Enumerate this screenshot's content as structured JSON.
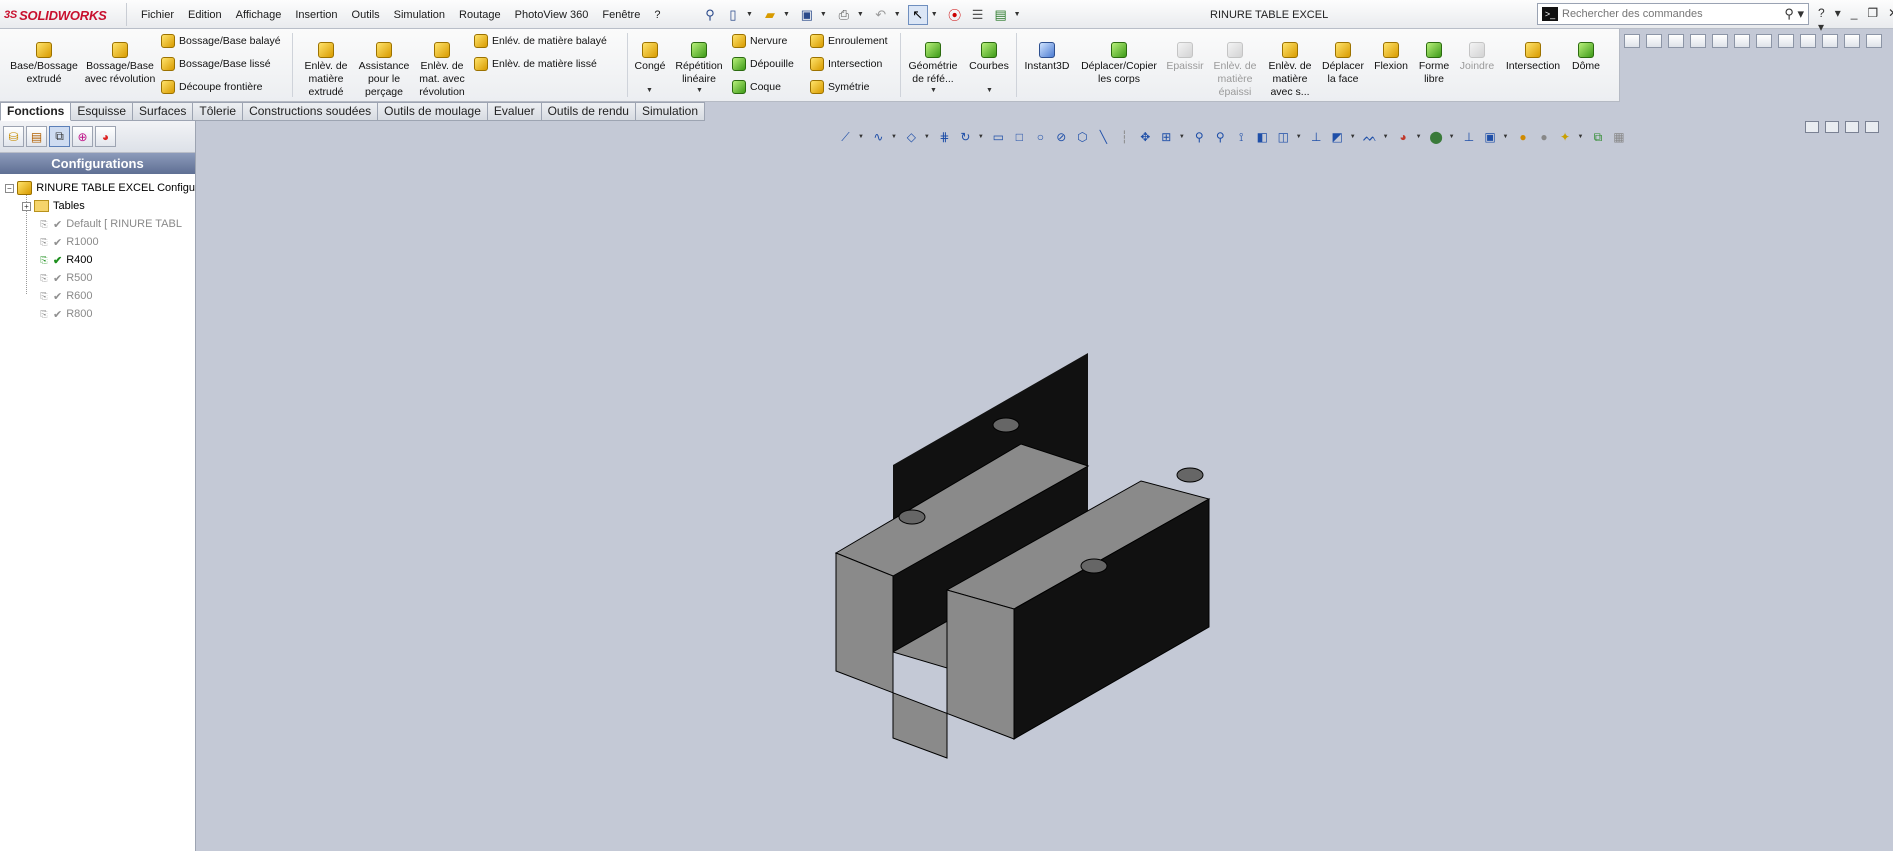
{
  "app": {
    "brand": "SOLIDWORKS",
    "brand_prefix": "3S",
    "document_title": "RINURE TABLE EXCEL",
    "brand_color": "#c8102e"
  },
  "menu": [
    "Fichier",
    "Edition",
    "Affichage",
    "Insertion",
    "Outils",
    "Simulation",
    "Routage",
    "PhotoView 360",
    "Fenêtre",
    "?"
  ],
  "search": {
    "placeholder": "Rechercher des commandes"
  },
  "quick_toolbar": {
    "icons": [
      "pin-icon",
      "new-document-icon",
      "open-icon",
      "save-icon",
      "print-icon",
      "undo-icon",
      "select-icon",
      "traffic-light-icon",
      "options-icon",
      "customize-icon"
    ]
  },
  "commands": {
    "large": [
      {
        "label": "Base/Bossage extrudé",
        "icon": "extruded-boss-icon",
        "enabled": true
      },
      {
        "label": "Bossage/Base avec révolution",
        "icon": "revolved-boss-icon",
        "enabled": true
      },
      {
        "label": "Enlèv. de matière extrudé",
        "icon": "extruded-cut-icon",
        "enabled": true
      },
      {
        "label": "Assistance pour le perçage",
        "icon": "hole-wizard-icon",
        "enabled": true
      },
      {
        "label": "Enlèv. de mat. avec révolution",
        "icon": "revolved-cut-icon",
        "enabled": true
      },
      {
        "label": "Congé",
        "icon": "fillet-icon",
        "enabled": true
      },
      {
        "label": "Répétition linéaire",
        "icon": "linear-pattern-icon",
        "enabled": true
      },
      {
        "label": "Géométrie de réfé...",
        "icon": "reference-geometry-icon",
        "enabled": true
      },
      {
        "label": "Courbes",
        "icon": "curves-icon",
        "enabled": true
      },
      {
        "label": "Instant3D",
        "icon": "instant3d-icon",
        "enabled": true
      },
      {
        "label": "Déplacer/Copier les corps",
        "icon": "move-copy-bodies-icon",
        "enabled": true
      },
      {
        "label": "Epaissir",
        "icon": "thicken-icon",
        "enabled": false
      },
      {
        "label": "Enlèv. de matière épaissi",
        "icon": "thickened-cut-icon",
        "enabled": false
      },
      {
        "label": "Enlèv. de matière avec s...",
        "icon": "surface-cut-icon",
        "enabled": true
      },
      {
        "label": "Déplacer la face",
        "icon": "move-face-icon",
        "enabled": true
      },
      {
        "label": "Flexion",
        "icon": "flex-icon",
        "enabled": true
      },
      {
        "label": "Forme libre",
        "icon": "freeform-icon",
        "enabled": true
      },
      {
        "label": "Joindre",
        "icon": "join-icon",
        "enabled": false
      },
      {
        "label": "Intersection",
        "icon": "intersect-icon",
        "enabled": true
      },
      {
        "label": "Dôme",
        "icon": "dome-icon",
        "enabled": true
      }
    ],
    "small": [
      {
        "label": "Bossage/Base balayé",
        "icon": "swept-boss-icon"
      },
      {
        "label": "Bossage/Base lissé",
        "icon": "lofted-boss-icon"
      },
      {
        "label": "Découpe frontière",
        "icon": "boundary-boss-icon"
      },
      {
        "label": "Enlév. de matière balayé",
        "icon": "swept-cut-icon"
      },
      {
        "label": "Enlèv. de matière lissé",
        "icon": "lofted-cut-icon"
      },
      {
        "label": "Nervure",
        "icon": "rib-icon"
      },
      {
        "label": "Dépouille",
        "icon": "draft-icon"
      },
      {
        "label": "Coque",
        "icon": "shell-icon"
      },
      {
        "label": "Enroulement",
        "icon": "wrap-icon"
      },
      {
        "label": "Intersection",
        "icon": "intersection-icon"
      },
      {
        "label": "Symétrie",
        "icon": "mirror-icon"
      }
    ]
  },
  "tabs": [
    {
      "label": "Fonctions",
      "active": true
    },
    {
      "label": "Esquisse",
      "active": false
    },
    {
      "label": "Surfaces",
      "active": false
    },
    {
      "label": "Tôlerie",
      "active": false
    },
    {
      "label": "Constructions soudées",
      "active": false
    },
    {
      "label": "Outils de moulage",
      "active": false
    },
    {
      "label": "Evaluer",
      "active": false
    },
    {
      "label": "Outils de rendu",
      "active": false
    },
    {
      "label": "Simulation",
      "active": false
    }
  ],
  "panel": {
    "title": "Configurations",
    "tree": {
      "root": "RINURE TABLE EXCEL Configu",
      "tables": "Tables",
      "configs": [
        {
          "name": "Default [ RINURE TABL",
          "active": false
        },
        {
          "name": "R1000",
          "active": false
        },
        {
          "name": "R400",
          "active": true
        },
        {
          "name": "R500",
          "active": false
        },
        {
          "name": "R600",
          "active": false
        },
        {
          "name": "R800",
          "active": false
        }
      ]
    }
  },
  "colors": {
    "model_light": "#8a8a8a",
    "model_dark": "#111111",
    "viewport_bg": "#c4c9d6",
    "active_check": "#1d8f1d"
  }
}
